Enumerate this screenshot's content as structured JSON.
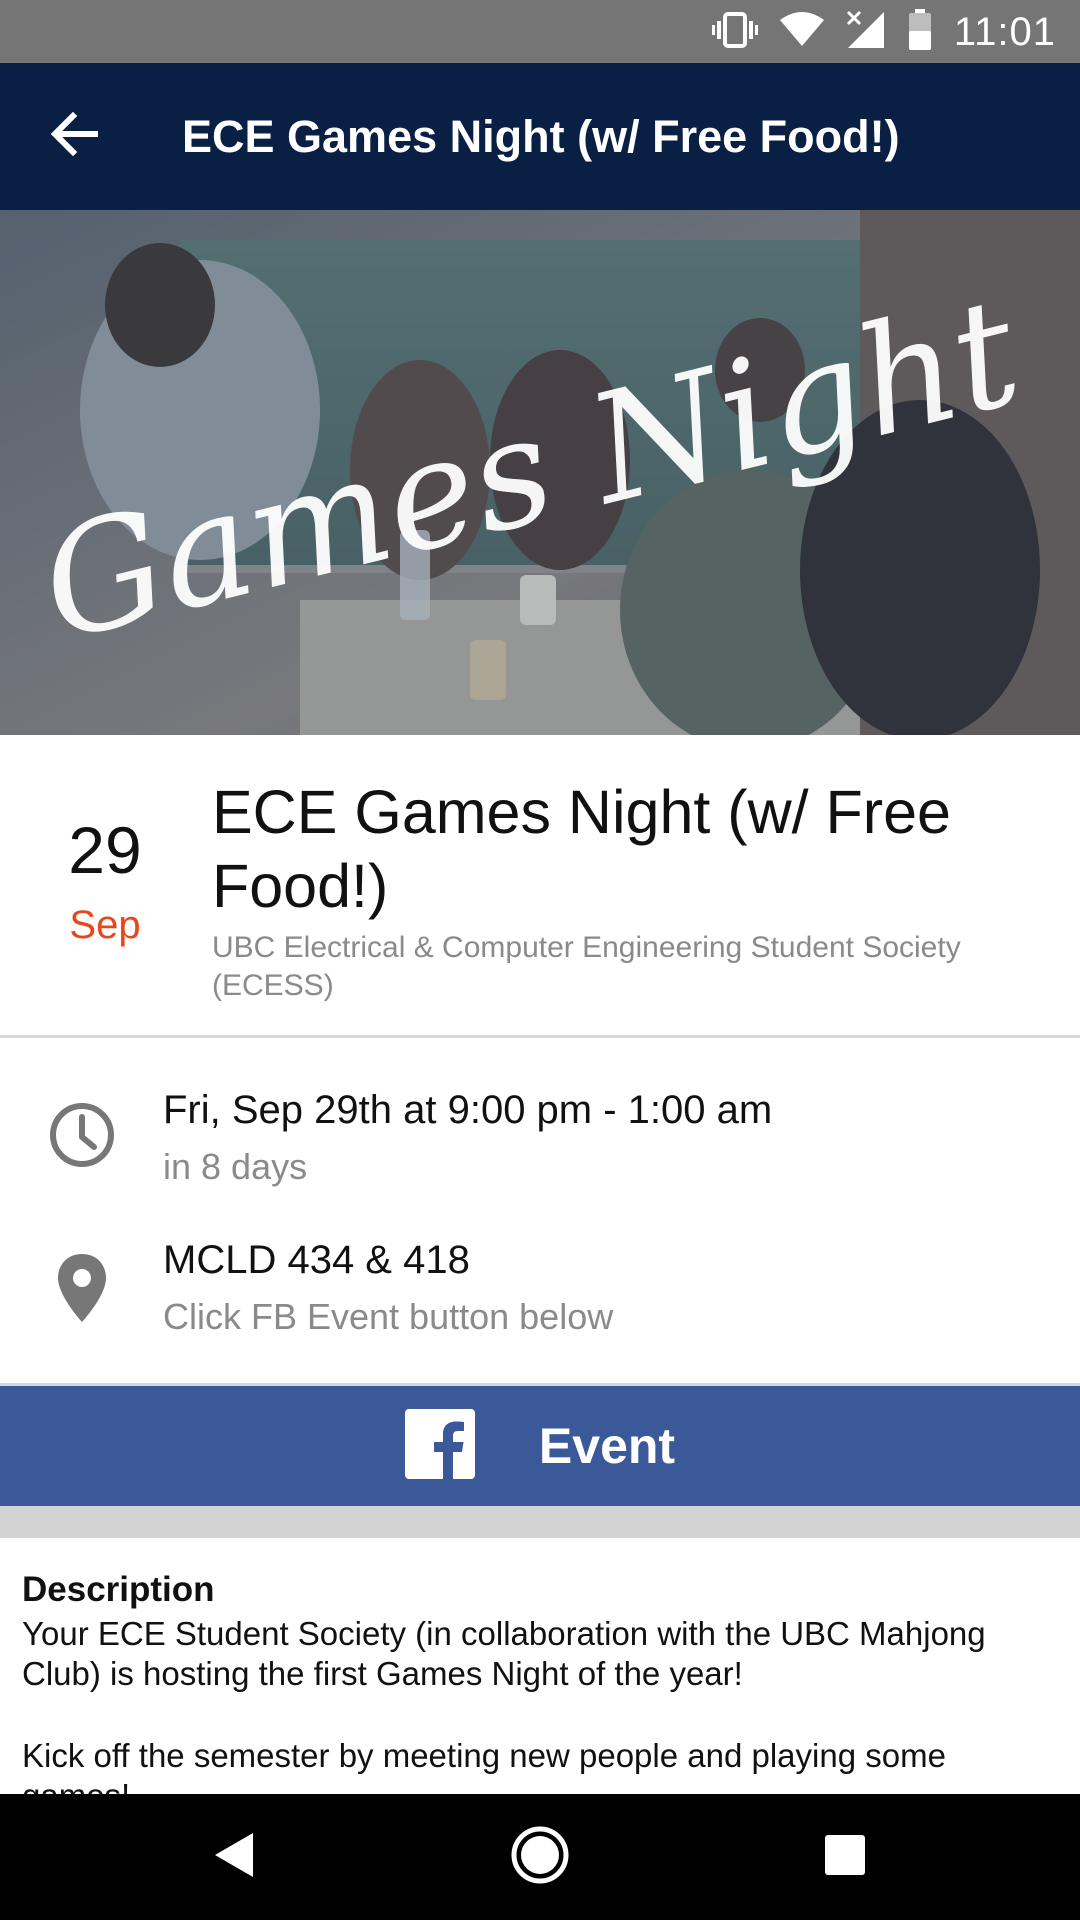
{
  "status_bar": {
    "time": "11:01",
    "icons": [
      "vibrate-icon",
      "wifi-icon",
      "signal-off-icon",
      "battery-icon"
    ]
  },
  "app_bar": {
    "title": "ECE Games Night (w/ Free Food!)",
    "back_icon": "arrow-back-icon"
  },
  "hero": {
    "overlay_text": "Games Night"
  },
  "event": {
    "day": "29",
    "month": "Sep",
    "title": "ECE Games Night (w/ Free Food!)",
    "organizer": "UBC Electrical & Computer Engineering Student Society (ECESS)"
  },
  "when": {
    "icon": "clock-icon",
    "main": "Fri, Sep 29th at 9:00 pm - 1:00 am",
    "sub": "in 8 days"
  },
  "where": {
    "icon": "location-pin-icon",
    "main": "MCLD 434 & 418",
    "sub": "Click FB Event button below"
  },
  "fb_button": {
    "icon": "facebook-icon",
    "label": "Event"
  },
  "description": {
    "heading": "Description",
    "paragraphs": [
      "Your ECE Student Society (in collaboration with the UBC Mahjong Club) is hosting the first Games Night of the year!",
      "Kick off the semester by meeting new people and playing some games!"
    ]
  },
  "nav_bar": {
    "icons": [
      "back-triangle-icon",
      "home-circle-icon",
      "recents-square-icon"
    ]
  },
  "colors": {
    "status_bar": "#757575",
    "app_bar": "#0a1f44",
    "accent_month": "#e8471c",
    "facebook_blue": "#3b5998",
    "secondary_text": "#8a8a8a"
  }
}
